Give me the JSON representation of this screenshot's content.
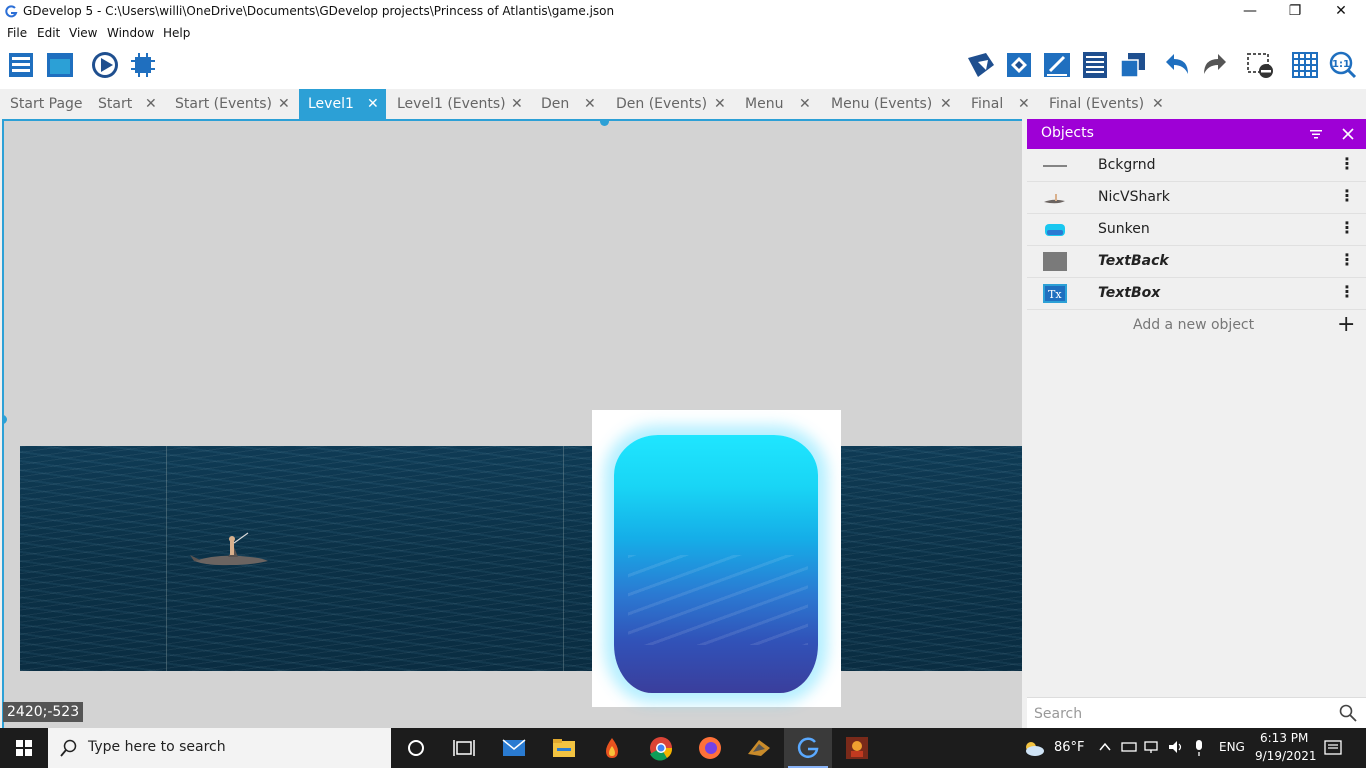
{
  "window": {
    "title": "GDevelop 5 - C:\\Users\\willi\\OneDrive\\Documents\\GDevelop projects\\Princess of Atlantis\\game.json",
    "minimize": "—",
    "restore": "❐",
    "close": "✕"
  },
  "menu": [
    "File",
    "Edit",
    "View",
    "Window",
    "Help"
  ],
  "tabs": [
    {
      "label": "Start Page",
      "closable": false
    },
    {
      "label": "Start",
      "closable": true
    },
    {
      "label": "Start (Events)",
      "closable": true
    },
    {
      "label": "Level1",
      "closable": true,
      "active": true
    },
    {
      "label": "Level1 (Events)",
      "closable": true
    },
    {
      "label": "Den",
      "closable": true
    },
    {
      "label": "Den (Events)",
      "closable": true
    },
    {
      "label": "Menu",
      "closable": true
    },
    {
      "label": "Menu (Events)",
      "closable": true
    },
    {
      "label": "Final",
      "closable": true
    },
    {
      "label": "Final (Events)",
      "closable": true
    }
  ],
  "tab_close_glyph": "✕",
  "scene": {
    "coordinates": "2420;-523"
  },
  "objects_panel": {
    "title": "Objects",
    "items": [
      {
        "name": "Bckgrnd",
        "icon": "line-icon",
        "style": "normal"
      },
      {
        "name": "NicVShark",
        "icon": "shark-thumbnail",
        "style": "normal"
      },
      {
        "name": "Sunken",
        "icon": "sunken-thumbnail",
        "style": "normal"
      },
      {
        "name": "TextBack",
        "icon": "gray-box-icon",
        "style": "bold-italic"
      },
      {
        "name": "TextBox",
        "icon": "text-icon",
        "style": "bold-italic"
      }
    ],
    "more_glyph": "⋮",
    "add_label": "Add a new object",
    "add_glyph": "+",
    "search_placeholder": "Search"
  },
  "taskbar": {
    "search_placeholder": "Type here to search",
    "weather": "86°F",
    "language": "ENG",
    "time": "6:13 PM",
    "date": "9/19/2021"
  },
  "colors": {
    "accent": "#2ca0d6",
    "objects_header": "#9e00d6",
    "scene_bg": "#d3d3d3"
  }
}
